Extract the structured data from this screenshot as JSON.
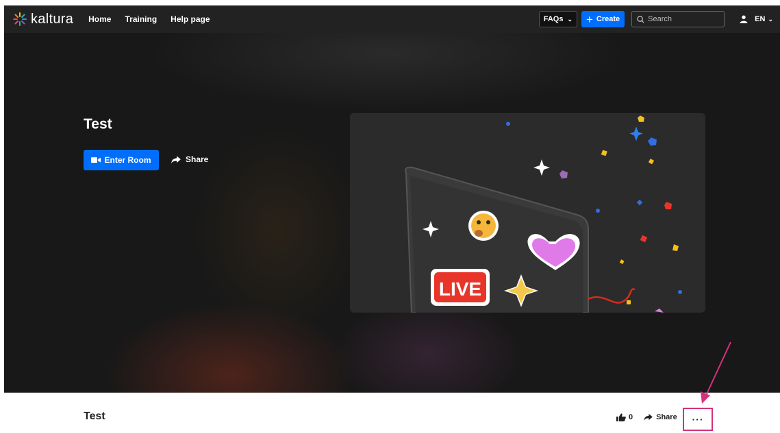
{
  "brand": {
    "name": "kaltura"
  },
  "nav": {
    "links": [
      "Home",
      "Training",
      "Help page"
    ],
    "faqs_label": "FAQs",
    "create_label": "Create",
    "search_placeholder": "Search",
    "language": "EN"
  },
  "hero": {
    "title": "Test",
    "enter_room_label": "Enter Room",
    "share_label": "Share",
    "thumbnail": {
      "badge_text": "LIVE"
    }
  },
  "entry": {
    "title": "Test",
    "like_count": "0",
    "share_label": "Share",
    "more_label": "···"
  },
  "colors": {
    "accent": "#006efa",
    "annotation": "#d4317a",
    "topbar": "#222222"
  }
}
